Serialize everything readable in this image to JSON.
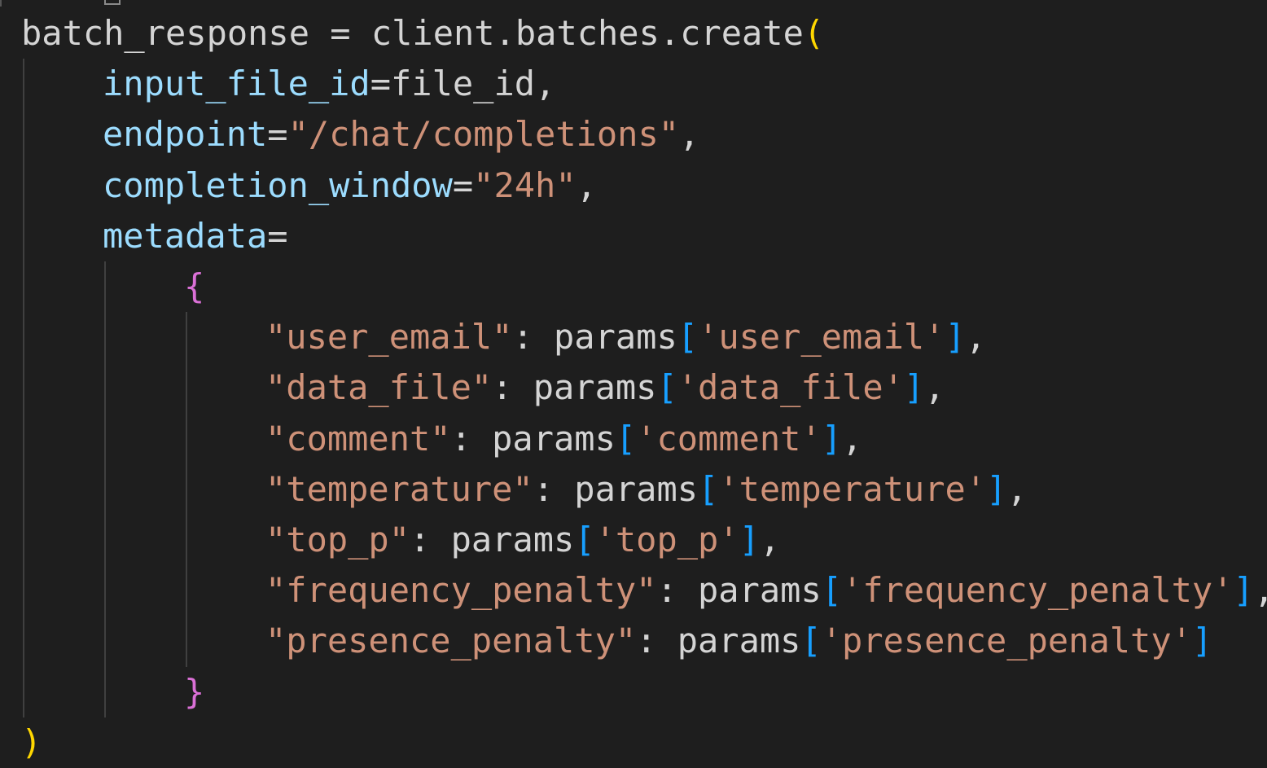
{
  "editor": {
    "language": "python",
    "colors": {
      "background": "#1e1e1e",
      "default_text": "#d4d4d4",
      "parameter": "#9cdcfe",
      "string": "#ce9178",
      "paren_gold": "#ffd700",
      "brace_magenta": "#da70d6",
      "bracket_blue": "#179fff",
      "indent_guide": "#404040"
    },
    "lines": [
      {
        "indent": 0,
        "tokens": [
          {
            "text": "batch_response = client.batches.create",
            "kind": "default_text"
          },
          {
            "text": "(",
            "kind": "paren_gold"
          }
        ]
      },
      {
        "indent": 4,
        "tokens": [
          {
            "text": "input_file_id",
            "kind": "parameter"
          },
          {
            "text": "=file_id,",
            "kind": "default_text"
          }
        ]
      },
      {
        "indent": 4,
        "tokens": [
          {
            "text": "endpoint",
            "kind": "parameter"
          },
          {
            "text": "=",
            "kind": "default_text"
          },
          {
            "text": "\"/chat/completions\"",
            "kind": "string"
          },
          {
            "text": ",",
            "kind": "default_text"
          }
        ]
      },
      {
        "indent": 4,
        "tokens": [
          {
            "text": "completion_window",
            "kind": "parameter"
          },
          {
            "text": "=",
            "kind": "default_text"
          },
          {
            "text": "\"24h\"",
            "kind": "string"
          },
          {
            "text": ",",
            "kind": "default_text"
          }
        ]
      },
      {
        "indent": 4,
        "tokens": [
          {
            "text": "metadata",
            "kind": "parameter"
          },
          {
            "text": "=",
            "kind": "default_text"
          }
        ]
      },
      {
        "indent": 8,
        "tokens": [
          {
            "text": "{",
            "kind": "brace_magenta"
          }
        ]
      },
      {
        "indent": 12,
        "tokens": [
          {
            "text": "\"user_email\"",
            "kind": "string"
          },
          {
            "text": ": params",
            "kind": "default_text"
          },
          {
            "text": "[",
            "kind": "bracket_blue"
          },
          {
            "text": "'user_email'",
            "kind": "string"
          },
          {
            "text": "]",
            "kind": "bracket_blue"
          },
          {
            "text": ",",
            "kind": "default_text"
          }
        ]
      },
      {
        "indent": 12,
        "tokens": [
          {
            "text": "\"data_file\"",
            "kind": "string"
          },
          {
            "text": ": params",
            "kind": "default_text"
          },
          {
            "text": "[",
            "kind": "bracket_blue"
          },
          {
            "text": "'data_file'",
            "kind": "string"
          },
          {
            "text": "]",
            "kind": "bracket_blue"
          },
          {
            "text": ",",
            "kind": "default_text"
          }
        ]
      },
      {
        "indent": 12,
        "tokens": [
          {
            "text": "\"comment\"",
            "kind": "string"
          },
          {
            "text": ": params",
            "kind": "default_text"
          },
          {
            "text": "[",
            "kind": "bracket_blue"
          },
          {
            "text": "'comment'",
            "kind": "string"
          },
          {
            "text": "]",
            "kind": "bracket_blue"
          },
          {
            "text": ",",
            "kind": "default_text"
          }
        ]
      },
      {
        "indent": 12,
        "tokens": [
          {
            "text": "\"temperature\"",
            "kind": "string"
          },
          {
            "text": ": params",
            "kind": "default_text"
          },
          {
            "text": "[",
            "kind": "bracket_blue"
          },
          {
            "text": "'temperature'",
            "kind": "string"
          },
          {
            "text": "]",
            "kind": "bracket_blue"
          },
          {
            "text": ",",
            "kind": "default_text"
          }
        ]
      },
      {
        "indent": 12,
        "tokens": [
          {
            "text": "\"top_p\"",
            "kind": "string"
          },
          {
            "text": ": params",
            "kind": "default_text"
          },
          {
            "text": "[",
            "kind": "bracket_blue"
          },
          {
            "text": "'top_p'",
            "kind": "string"
          },
          {
            "text": "]",
            "kind": "bracket_blue"
          },
          {
            "text": ",",
            "kind": "default_text"
          }
        ]
      },
      {
        "indent": 12,
        "tokens": [
          {
            "text": "\"frequency_penalty\"",
            "kind": "string"
          },
          {
            "text": ": params",
            "kind": "default_text"
          },
          {
            "text": "[",
            "kind": "bracket_blue"
          },
          {
            "text": "'frequency_penalty'",
            "kind": "string"
          },
          {
            "text": "]",
            "kind": "bracket_blue"
          },
          {
            "text": ",",
            "kind": "default_text"
          }
        ]
      },
      {
        "indent": 12,
        "tokens": [
          {
            "text": "\"presence_penalty\"",
            "kind": "string"
          },
          {
            "text": ": params",
            "kind": "default_text"
          },
          {
            "text": "[",
            "kind": "bracket_blue"
          },
          {
            "text": "'presence_penalty'",
            "kind": "string"
          },
          {
            "text": "]",
            "kind": "bracket_blue"
          }
        ]
      },
      {
        "indent": 8,
        "tokens": [
          {
            "text": "}",
            "kind": "brace_magenta"
          }
        ]
      },
      {
        "indent": 0,
        "tokens": [
          {
            "text": ")",
            "kind": "paren_gold"
          }
        ]
      }
    ]
  }
}
